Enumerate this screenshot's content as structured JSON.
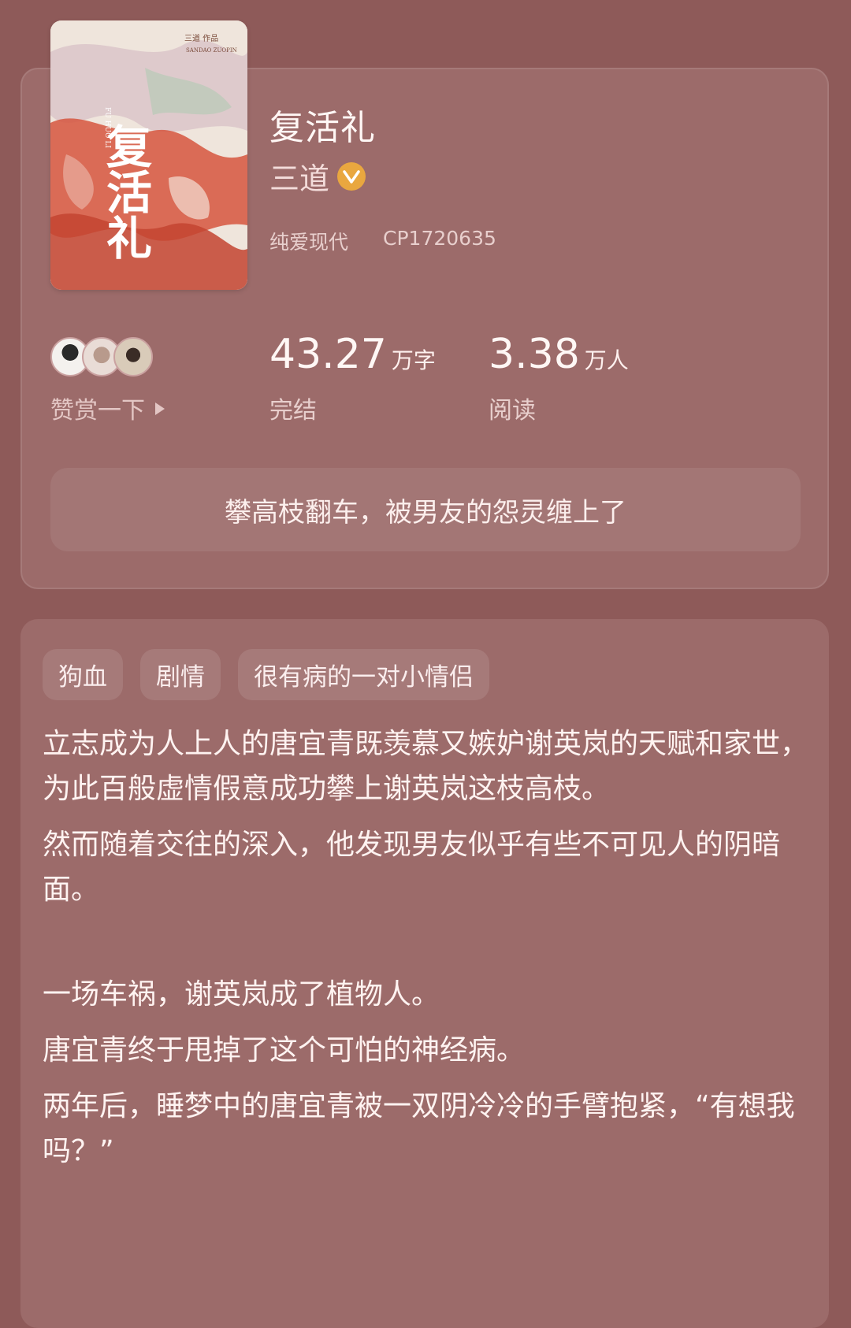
{
  "book": {
    "title": "复活礼",
    "author": "三道",
    "category": "纯爱现代",
    "cp_id": "CP1720635"
  },
  "cover": {
    "author_work": "三道 作品",
    "pinyin_work": "SANDAO ZUOPIN",
    "title_chars": "复活礼",
    "pinyin_title": "FU HUO LI"
  },
  "stats": {
    "word_count": "43.27",
    "word_unit": "万字",
    "word_label": "完结",
    "reader_count": "3.38",
    "reader_unit": "万人",
    "reader_label": "阅读"
  },
  "reward": {
    "label": "赞赏一下"
  },
  "tagline": "攀高枝翻车，被男友的怨灵缠上了",
  "tags": [
    "狗血",
    "剧情",
    "很有病的一对小情侣"
  ],
  "description": [
    "立志成为人上人的唐宜青既羡慕又嫉妒谢英岚的天赋和家世，为此百般虚情假意成功攀上谢英岚这枝高枝。",
    "然而随着交往的深入，他发现男友似乎有些不可见人的阴暗面。",
    "",
    "一场车祸，谢英岚成了植物人。",
    "唐宜青终于甩掉了这个可怕的神经病。",
    "两年后，睡梦中的唐宜青被一双阴冷冷的手臂抱紧，“有想我吗？”"
  ],
  "colors": {
    "background": "#8e5a59",
    "card": "#9c6b6a",
    "verified": "#e9a73f"
  },
  "icons": {
    "verified": "verified-badge-icon",
    "reward_arrow": "play-triangle-icon"
  }
}
